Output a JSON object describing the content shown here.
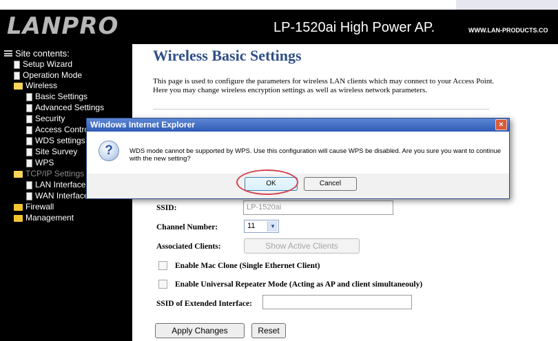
{
  "header": {
    "logo": "LANPRO",
    "product": "LP-1520ai High Power AP.",
    "site": "WWW.LAN-PRODUCTS.CO"
  },
  "sidebar": {
    "title": "Site contents:",
    "items": [
      {
        "label": "Setup Wizard",
        "icon": "doc-icon"
      },
      {
        "label": "Operation Mode",
        "icon": "doc-icon"
      },
      {
        "label": "Wireless",
        "icon": "folder-open-icon"
      },
      {
        "label": "Basic Settings",
        "icon": "doc-icon"
      },
      {
        "label": "Advanced Settings",
        "icon": "doc-icon"
      },
      {
        "label": "Security",
        "icon": "doc-icon"
      },
      {
        "label": "Access Control",
        "icon": "doc-icon"
      },
      {
        "label": "WDS settings",
        "icon": "doc-icon"
      },
      {
        "label": "Site Survey",
        "icon": "doc-icon"
      },
      {
        "label": "WPS",
        "icon": "doc-icon"
      },
      {
        "label": "TCP/IP Settings",
        "icon": "folder-open-icon"
      },
      {
        "label": "LAN Interface",
        "icon": "doc-icon"
      },
      {
        "label": "WAN Interface",
        "icon": "doc-icon"
      },
      {
        "label": "Firewall",
        "icon": "folder-icon"
      },
      {
        "label": "Management",
        "icon": "folder-icon"
      }
    ]
  },
  "main": {
    "title": "Wireless Basic Settings",
    "intro": "This page is used to configure the parameters for wireless LAN clients which may connect to your Access Point. Here you may change wireless encryption settings as well as wireless network parameters.",
    "ssid_label": "SSID:",
    "ssid_value": "LP-1520ai",
    "channel_label": "Channel Number:",
    "channel_value": "11",
    "clients_label": "Associated Clients:",
    "clients_button": "Show Active Clients",
    "mac_clone_label": "Enable Mac Clone (Single Ethernet Client)",
    "repeater_label": "Enable Universal Repeater Mode (Acting as AP and client simultaneouly)",
    "ext_ssid_label": "SSID of Extended Interface:",
    "apply_button": "Apply Changes",
    "reset_button": "Reset"
  },
  "dialog": {
    "title": "Windows Internet Explorer",
    "message": "WDS mode cannot be supported by WPS. Use this configuration will cause WPS be disabled. Are you sure you want to continue with the new setting?",
    "ok": "OK",
    "cancel": "Cancel",
    "close": "×",
    "icon": "question-icon"
  },
  "colors": {
    "title_blue": "#2f4f86",
    "dialog_titlebar": "#2f5bb6",
    "highlight_circle": "#d3434e"
  }
}
